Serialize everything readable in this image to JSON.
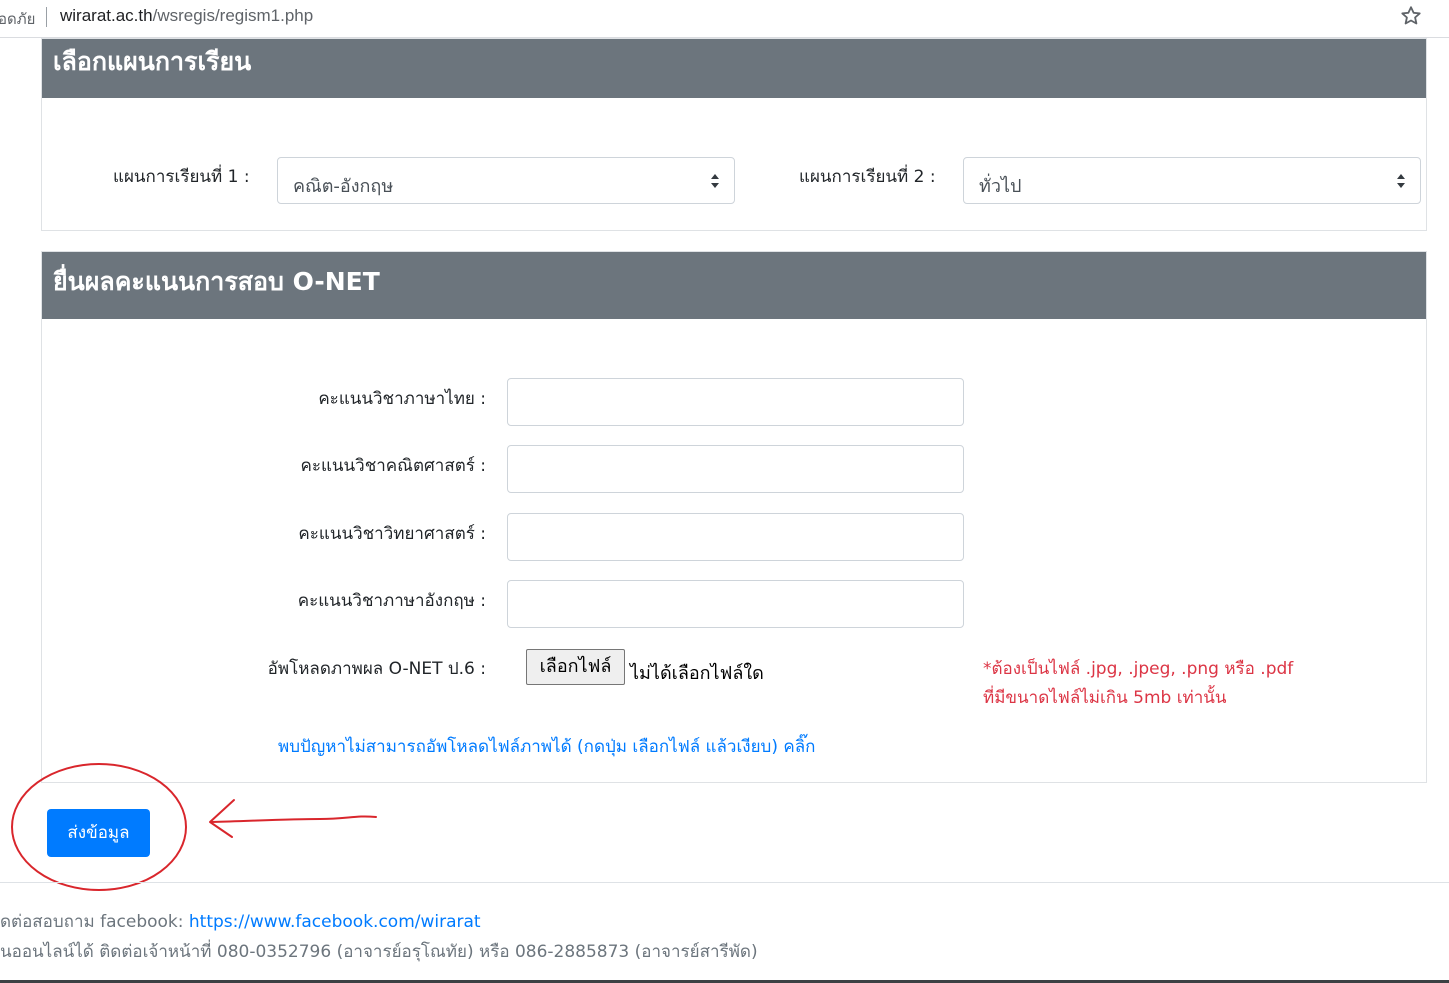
{
  "browser": {
    "security_text": "อดภัย",
    "url_host": "wirarat.ac.th",
    "url_path": "/wsregis/regism1.php"
  },
  "plan_card": {
    "title": "เลือกแผนการเรียน",
    "plan1_label": "แผนการเรียนที่ 1 :",
    "plan1_value": "คณิต-อังกฤษ",
    "plan2_label": "แผนการเรียนที่ 2 :",
    "plan2_value": "ทั่วไป"
  },
  "onet_card": {
    "title": "ยื่นผลคะแนนการสอบ O-NET",
    "fields": [
      {
        "label": "คะแนนวิชาภาษาไทย :",
        "value": ""
      },
      {
        "label": "คะแนนวิชาคณิตศาสตร์ :",
        "value": ""
      },
      {
        "label": "คะแนนวิชาวิทยาศาสตร์ :",
        "value": ""
      },
      {
        "label": "คะแนนวิชาภาษาอังกฤษ :",
        "value": ""
      }
    ],
    "upload_label": "อัพโหลดภาพผล O-NET ป.6 :",
    "file_button": "เลือกไฟล์",
    "file_status": "ไม่ได้เลือกไฟล์ใด",
    "file_note_line1": "*ต้องเป็นไฟล์ .jpg, .jpeg, .png หรือ .pdf",
    "file_note_line2": "ที่มีขนาดไฟล์ไม่เกิน 5mb เท่านั้น",
    "help_link": "พบปัญหาไม่สามารถอัพโหลดไฟล์ภาพได้ (กดปุ่ม เลือกไฟล์ แล้วเงียบ) คลิ๊ก"
  },
  "submit_label": "ส่งข้อมูล",
  "footer": {
    "line1_prefix": "ดต่อสอบถาม facebook: ",
    "line1_link": "https://www.facebook.com/wirarat",
    "line2": "นออนไลน์ได้ ติดต่อเจ้าหน้าที่ 080-0352796 (อาจารย์อรุโณทัย) หรือ 086-2885873 (อาจารย์สารีพัด)"
  },
  "colors": {
    "card_header": "#6c757d",
    "primary": "#007bff",
    "danger": "#dc3545",
    "annotation": "#d9262c"
  },
  "icons": {
    "bookmark": "star-icon",
    "select": "select-arrows-icon"
  }
}
